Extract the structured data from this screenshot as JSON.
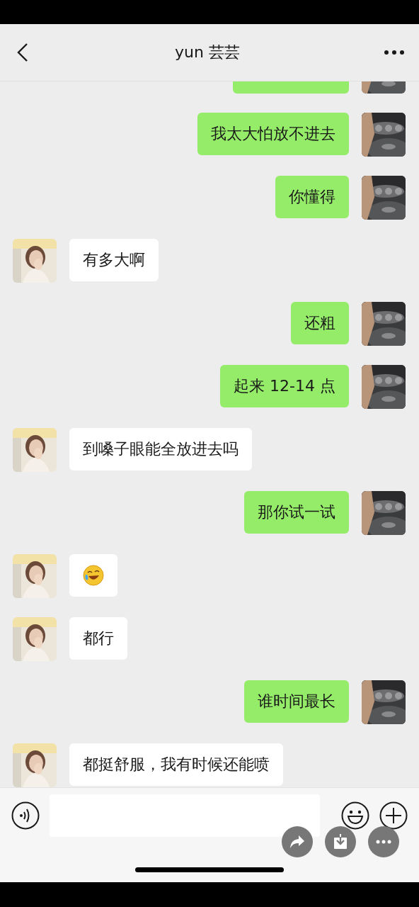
{
  "header": {
    "title": "yun 芸芸"
  },
  "messages": [
    {
      "kind": "sent_partial"
    },
    {
      "kind": "sent_text",
      "text": "我太大怕放不进去"
    },
    {
      "kind": "sent_text",
      "text": "你懂得"
    },
    {
      "kind": "received_text",
      "text": "有多大啊"
    },
    {
      "kind": "sent_text",
      "text": "还粗"
    },
    {
      "kind": "sent_text",
      "text": "起来 12-14 点"
    },
    {
      "kind": "received_text",
      "text": "到嗓子眼能全放进去吗"
    },
    {
      "kind": "sent_text",
      "text": "那你试一试"
    },
    {
      "kind": "received_emoji"
    },
    {
      "kind": "received_text",
      "text": "都行"
    },
    {
      "kind": "sent_text",
      "text": "谁时间最长"
    },
    {
      "kind": "received_text",
      "text": "都挺舒服，我有时候还能喷"
    }
  ]
}
